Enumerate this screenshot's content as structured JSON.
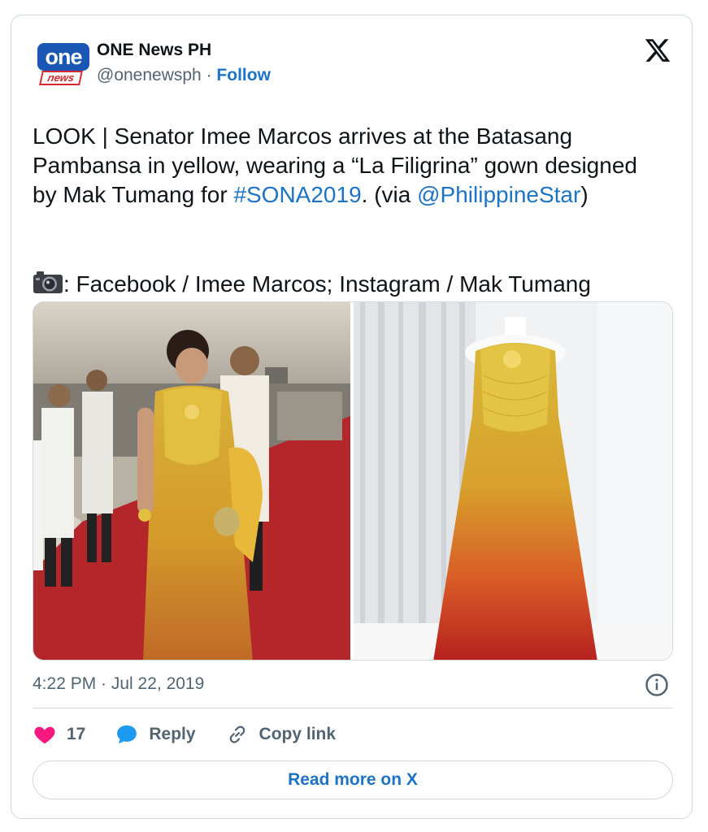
{
  "author": {
    "avatar_top": "one",
    "avatar_bottom": "news",
    "name": "ONE News PH",
    "handle": "@onenewsph",
    "separator": " · ",
    "follow_label": "Follow"
  },
  "tweet": {
    "text_part1": "LOOK | Senator Imee Marcos arrives at the Batasang Pambansa in yellow, wearing a “La Filigrina” gown designed by Mak Tumang for ",
    "hashtag": "#SONA2019",
    "text_part2": ". (via ",
    "mention": "@PhilippineStar",
    "text_part3": ")",
    "credit": ": Facebook / Imee Marcos; Instagram / Mak Tumang",
    "credit_icon": "camera-icon"
  },
  "media": {
    "photo_left": "Imee Marcos in gold gown on red carpet",
    "photo_right": "Gold-to-red ombre gown on mannequin"
  },
  "footer": {
    "timestamp": "4:22 PM · Jul 22, 2019",
    "like_count": "17",
    "reply_label": "Reply",
    "copy_link_label": "Copy link",
    "read_more_label": "Read more on X"
  },
  "colors": {
    "link": "#1d73c4",
    "heart": "#f91880",
    "reply_bubble": "#1d9bf0",
    "border": "#cfd9de"
  }
}
